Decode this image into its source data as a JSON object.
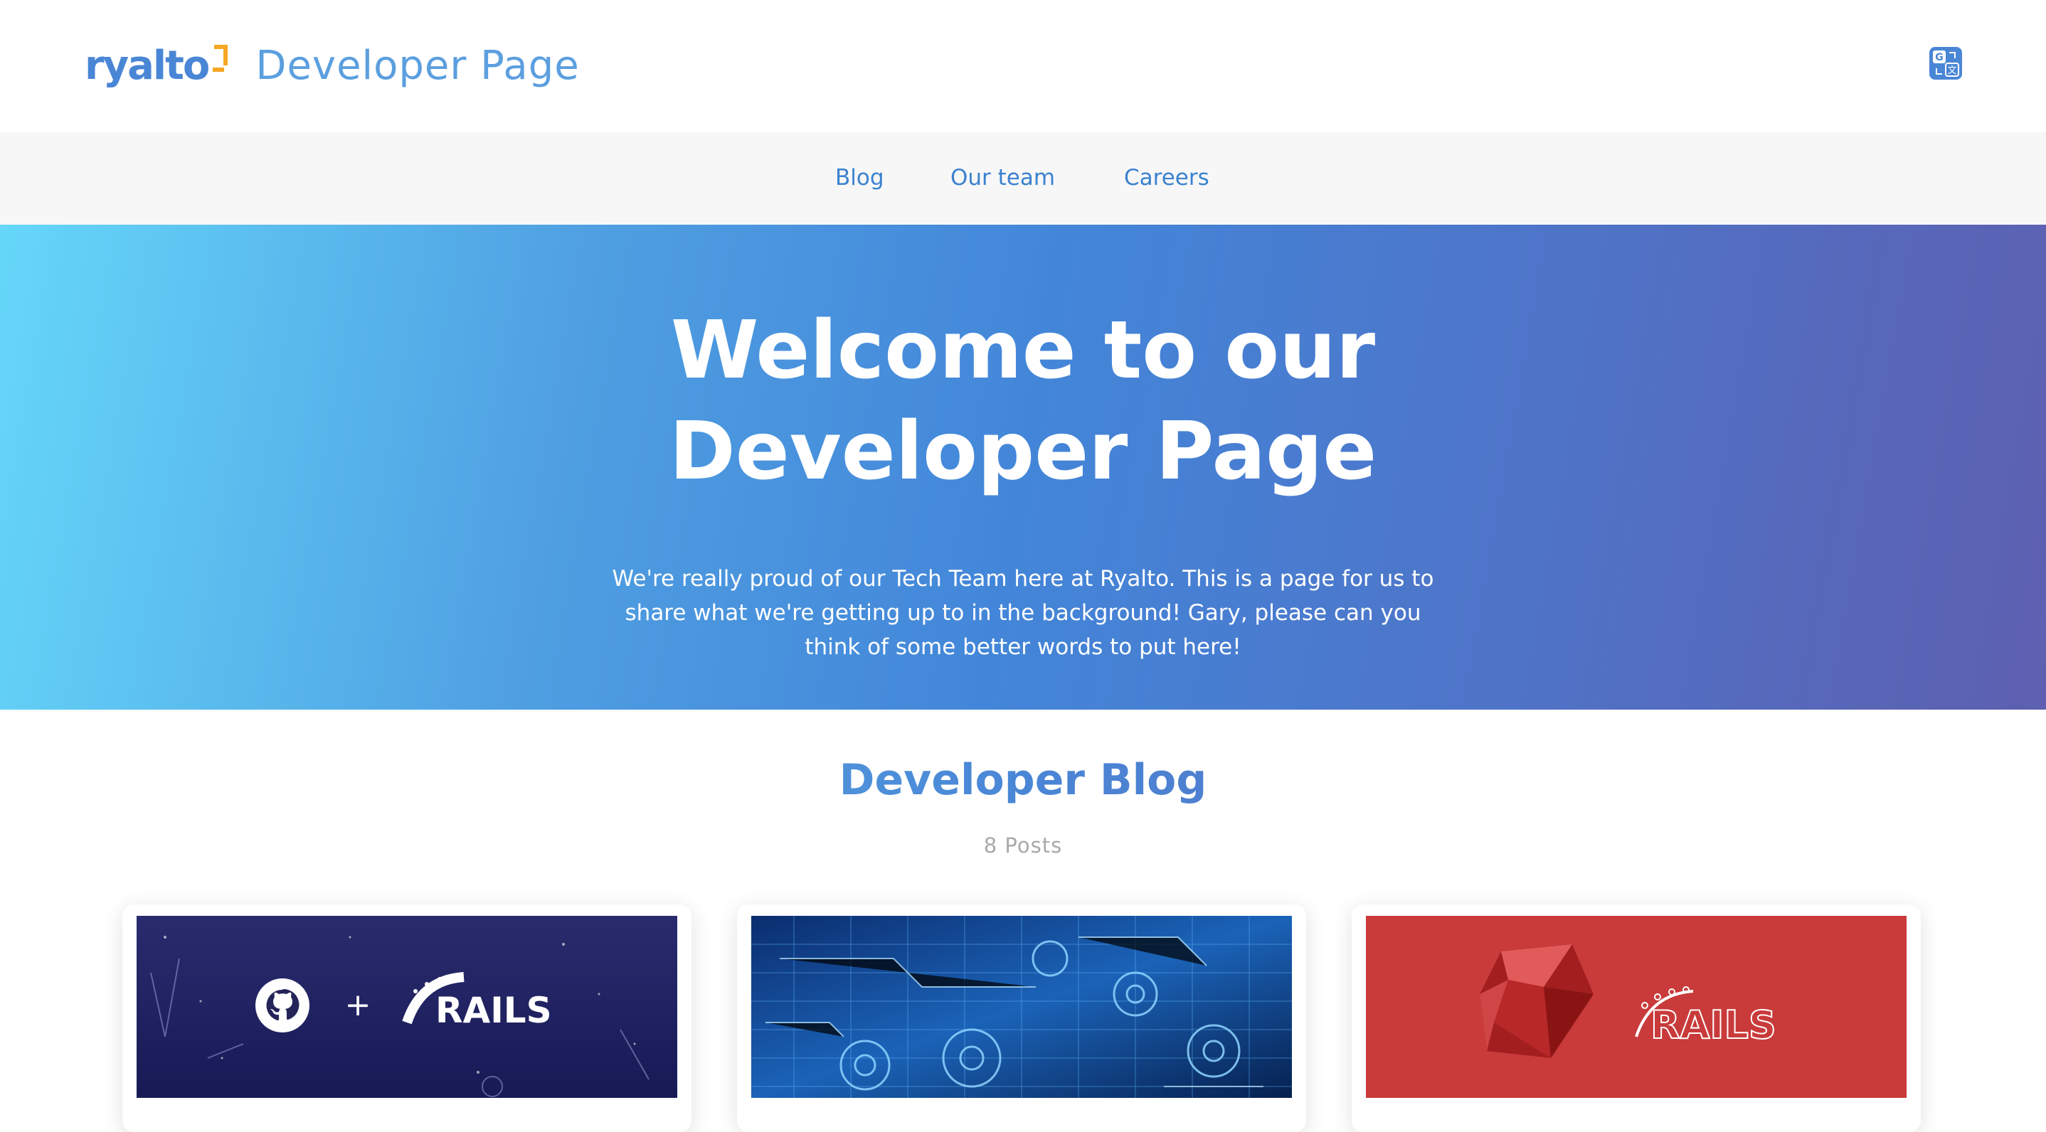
{
  "header": {
    "logo_text": "ryalto",
    "title": "Developer Page",
    "translate_icon": "translate-icon"
  },
  "nav": {
    "items": [
      {
        "label": "Blog"
      },
      {
        "label": "Our team"
      },
      {
        "label": "Careers"
      }
    ]
  },
  "hero": {
    "title_line1": "Welcome to our",
    "title_line2": "Developer Page",
    "text_line1": "We're really proud of our Tech Team here at Ryalto. This is a page for us to",
    "text_line2": "share what we're getting up to in the background! Gary, please can you",
    "text_line3": "think of some better words to put here!"
  },
  "blog": {
    "title": "Developer Blog",
    "count": "8 Posts",
    "cards": [
      {
        "image": "github-plus-rails-banner",
        "plus": "+",
        "rails": "RAILS"
      },
      {
        "image": "circuit-gears-banner"
      },
      {
        "image": "ruby-rails-banner",
        "rails": "RAILS"
      }
    ]
  },
  "colors": {
    "brand_blue": "#4a86d6",
    "brand_orange": "#f5a623",
    "hero_start": "#65d7f9",
    "hero_end": "#5e5fb0",
    "ruby_red": "#c93a3a"
  }
}
